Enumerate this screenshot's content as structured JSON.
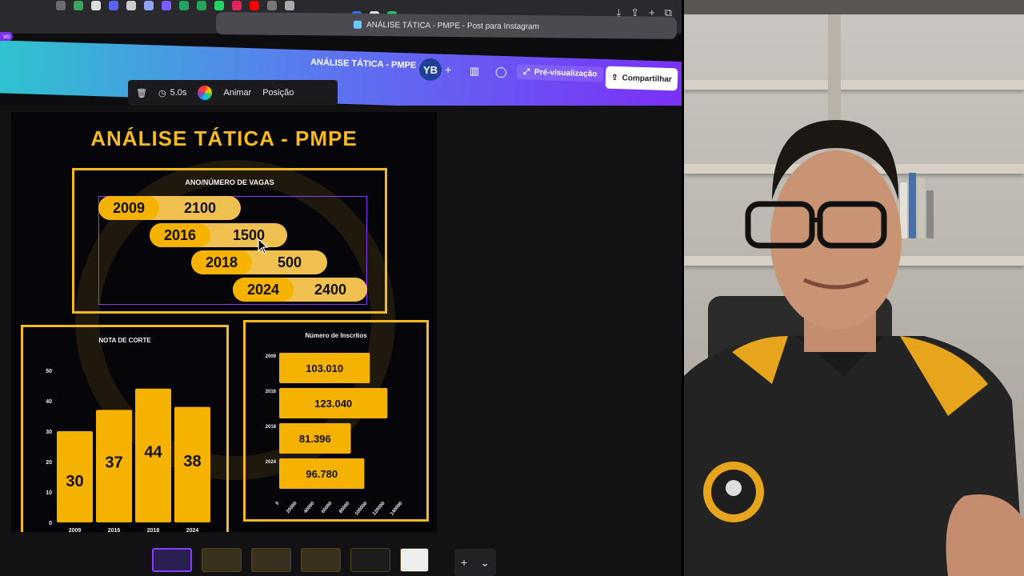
{
  "browser": {
    "tab_title": "ANÁLISE TÁTICA - PMPE - Post para Instagram",
    "badge": "vo"
  },
  "editor": {
    "design_title": "ANÁLISE TÁTICA - PMPE",
    "avatar_initials": "YB",
    "preview_label": "Pré-visualização",
    "share_label": "Compartilhar"
  },
  "toolbar": {
    "duration": "5.0s",
    "animate_label": "Animar",
    "position_label": "Posição"
  },
  "design": {
    "title": "ANÁLISE TÁTICA - PMPE",
    "vagas": {
      "title": "ANO/NÚMERO DE VAGAS",
      "rows": [
        {
          "year": "2009",
          "value": "2100"
        },
        {
          "year": "2016",
          "value": "1500"
        },
        {
          "year": "2018",
          "value": "500"
        },
        {
          "year": "2024",
          "value": "2400"
        }
      ]
    }
  },
  "chart_data": [
    {
      "type": "bar",
      "title": "NOTA DE CORTE",
      "categories": [
        "2009",
        "2016",
        "2018",
        "2024"
      ],
      "values": [
        30,
        37,
        44,
        38
      ],
      "ylim": [
        0,
        50
      ],
      "yticks": [
        0,
        10,
        20,
        30,
        40,
        50
      ],
      "color": "#f5b200"
    },
    {
      "type": "bar",
      "orientation": "horizontal",
      "title": "Número de Inscritos",
      "categories": [
        "2009",
        "2016",
        "2018",
        "2024"
      ],
      "values": [
        103010,
        123040,
        81396,
        96780
      ],
      "labels": [
        "103.010",
        "123.040",
        "81.396",
        "96.780"
      ],
      "xlim": [
        0,
        140000
      ],
      "xticks": [
        "0",
        "20000",
        "40000",
        "60000",
        "80000",
        "100000",
        "120000",
        "140000"
      ],
      "color": "#f5b200"
    }
  ],
  "colors": {
    "accent": "#f5b921",
    "canva_gradient_start": "#2ec5ce",
    "canva_gradient_end": "#7b2ff7",
    "selection": "#8a3cff"
  }
}
